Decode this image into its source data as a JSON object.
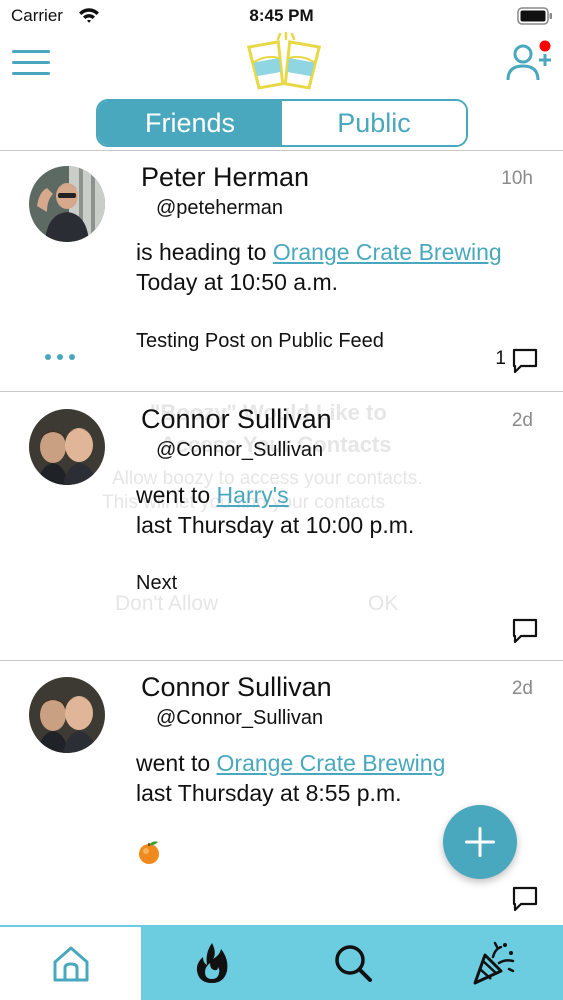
{
  "status_bar": {
    "carrier": "Carrier",
    "time": "8:45 PM"
  },
  "header": {
    "menu_icon": "hamburger-menu-icon",
    "logo": "cheers-glasses-logo",
    "add_friend_icon": "add-person-icon",
    "notification_dot_color": "#ff0000"
  },
  "tabs": {
    "friends": "Friends",
    "public": "Public",
    "selected": "Friends"
  },
  "accent_color": "#49a8bd",
  "tab_bar_color": "#6ccde0",
  "posts": [
    {
      "name": "Peter Herman",
      "handle": "@peteherman",
      "time": "10h",
      "action": "is heading to",
      "place": "Orange Crate Brewing",
      "when": "Today at 10:50 a.m.",
      "note": "Testing Post on Public Feed",
      "comment_count": "1"
    },
    {
      "name": "Connor Sullivan",
      "handle": "@Connor_Sullivan",
      "time": "2d",
      "action": "went to",
      "place": "Harry's",
      "when": "last Thursday at 10:00 p.m.",
      "note": "Next"
    },
    {
      "name": "Connor Sullivan",
      "handle": "@Connor_Sullivan",
      "time": "2d",
      "action": "went to",
      "place": "Orange Crate Brewing",
      "when": "last Thursday at 8:55 p.m.",
      "note_icon": "orange-emoji"
    }
  ],
  "faded_alert": {
    "title_line1": "\"Boozy\" Would Like to",
    "title_line2": "Access Your Contacts",
    "message_line1": "Allow boozy to access your contacts.",
    "message_line2": "This will let you find your contacts",
    "deny": "Don't Allow",
    "ok": "OK"
  },
  "bottom_tabs": [
    "home-icon",
    "flame-icon",
    "search-icon",
    "party-popper-icon"
  ]
}
